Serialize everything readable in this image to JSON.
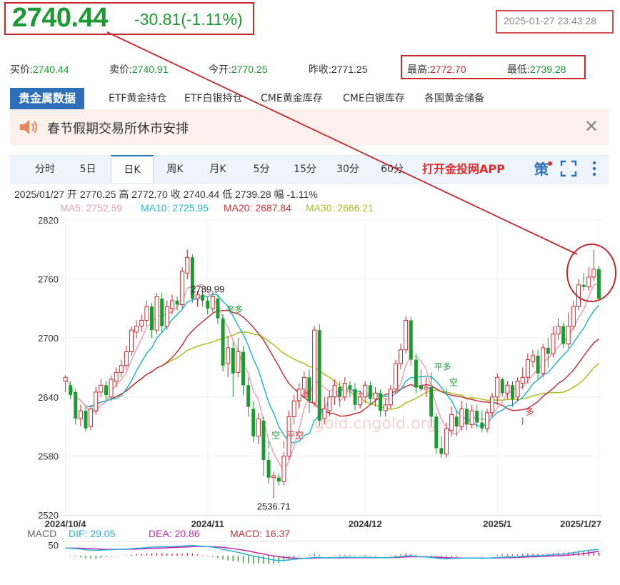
{
  "quote": {
    "price": "2740.44",
    "change": "-30.81(-1.11%)",
    "datetime": "2025-01-27 23:43:28",
    "bid_label": "买价:",
    "bid": "2740.44",
    "ask_label": "卖价:",
    "ask": "2740.91",
    "open_label": "今开:",
    "open": "2770.25",
    "prev_label": "昨收:",
    "prev": "2771.25",
    "high_label": "最高:",
    "high": "2772.70",
    "low_label": "最低:",
    "low": "2739.28"
  },
  "tabs": [
    "贵金属数据",
    "ETF黄金持仓",
    "ETF白银持仓",
    "CME黄金库存",
    "CME白银库存",
    "各国黄金储备"
  ],
  "notice": {
    "text": "春节假期交易所休市安排",
    "close": "✕"
  },
  "period_tabs": [
    "分时",
    "5日",
    "日K",
    "周K",
    "月K",
    "5分",
    "15分",
    "30分",
    "60分"
  ],
  "active_period": "日K",
  "app_link": "打开金投网APP",
  "ce_label": "策",
  "ohlc_line": "2025/01/27  开 2770.25  高 2772.70  收 2740.44  低 2739.28  幅 -1.11%",
  "ma": {
    "ma5": "MA5: 2752.59",
    "ma10": "MA10: 2725.95",
    "ma20": "MA20: 2687.84",
    "ma30": "MA30: 2666.21",
    "colors": {
      "ma5": "#f0a0b4",
      "ma10": "#27b3d8",
      "ma20": "#c8323c",
      "ma30": "#a8c020"
    }
  },
  "colors": {
    "up": "#d0272c",
    "down": "#1a9a30",
    "accent": "#2d6fb8",
    "box": "#c8262b",
    "dif": "#27b3d8",
    "dea": "#c02aa8"
  },
  "watermark": "gold.cngold.org",
  "chart_data": {
    "type": "candlestick",
    "ylim": [
      2520,
      2820
    ],
    "yticks": [
      2520,
      2580,
      2640,
      2700,
      2760,
      2820
    ],
    "x_labels": [
      {
        "i": 0,
        "label": "2024/10/4"
      },
      {
        "i": 28,
        "label": "2024/11"
      },
      {
        "i": 59,
        "label": "2024/12"
      },
      {
        "i": 85,
        "label": "2025/1"
      },
      {
        "i": 105,
        "label": "2025/1/27"
      }
    ],
    "candles": [
      [
        2656,
        2660,
        2645,
        2662
      ],
      [
        2652,
        2642,
        2638,
        2656
      ],
      [
        2645,
        2618,
        2612,
        2648
      ],
      [
        2618,
        2626,
        2610,
        2632
      ],
      [
        2626,
        2608,
        2605,
        2630
      ],
      [
        2610,
        2628,
        2606,
        2632
      ],
      [
        2626,
        2645,
        2622,
        2650
      ],
      [
        2645,
        2652,
        2640,
        2658
      ],
      [
        2652,
        2642,
        2636,
        2656
      ],
      [
        2640,
        2658,
        2636,
        2662
      ],
      [
        2656,
        2665,
        2650,
        2670
      ],
      [
        2665,
        2672,
        2660,
        2678
      ],
      [
        2672,
        2686,
        2668,
        2692
      ],
      [
        2686,
        2708,
        2682,
        2712
      ],
      [
        2706,
        2712,
        2700,
        2718
      ],
      [
        2712,
        2718,
        2706,
        2724
      ],
      [
        2718,
        2732,
        2712,
        2738
      ],
      [
        2732,
        2708,
        2700,
        2736
      ],
      [
        2708,
        2742,
        2704,
        2746
      ],
      [
        2740,
        2712,
        2706,
        2746
      ],
      [
        2712,
        2732,
        2708,
        2738
      ],
      [
        2730,
        2738,
        2724,
        2744
      ],
      [
        2738,
        2734,
        2728,
        2742
      ],
      [
        2734,
        2768,
        2730,
        2772
      ],
      [
        2766,
        2782,
        2760,
        2790
      ],
      [
        2782,
        2740,
        2736,
        2785
      ],
      [
        2740,
        2744,
        2732,
        2748
      ],
      [
        2744,
        2738,
        2732,
        2748
      ],
      [
        2738,
        2730,
        2724,
        2742
      ],
      [
        2730,
        2742,
        2726,
        2746
      ],
      [
        2740,
        2720,
        2714,
        2744
      ],
      [
        2720,
        2672,
        2666,
        2724
      ],
      [
        2674,
        2690,
        2660,
        2702
      ],
      [
        2690,
        2664,
        2640,
        2696
      ],
      [
        2665,
        2686,
        2660,
        2700
      ],
      [
        2686,
        2652,
        2642,
        2692
      ],
      [
        2652,
        2630,
        2620,
        2660
      ],
      [
        2628,
        2600,
        2594,
        2636
      ],
      [
        2600,
        2618,
        2592,
        2624
      ],
      [
        2616,
        2576,
        2560,
        2620
      ],
      [
        2576,
        2558,
        2552,
        2584
      ],
      [
        2558,
        2560,
        2537,
        2564
      ],
      [
        2558,
        2554,
        2550,
        2562
      ],
      [
        2554,
        2580,
        2550,
        2584
      ],
      [
        2580,
        2620,
        2576,
        2626
      ],
      [
        2620,
        2636,
        2612,
        2642
      ],
      [
        2636,
        2648,
        2628,
        2654
      ],
      [
        2648,
        2660,
        2640,
        2666
      ],
      [
        2660,
        2636,
        2624,
        2668
      ],
      [
        2634,
        2708,
        2630,
        2712
      ],
      [
        2708,
        2616,
        2610,
        2714
      ],
      [
        2618,
        2628,
        2612,
        2640
      ],
      [
        2626,
        2640,
        2620,
        2646
      ],
      [
        2640,
        2652,
        2632,
        2658
      ],
      [
        2650,
        2640,
        2630,
        2656
      ],
      [
        2640,
        2654,
        2636,
        2660
      ],
      [
        2652,
        2648,
        2640,
        2656
      ],
      [
        2648,
        2632,
        2626,
        2654
      ],
      [
        2632,
        2640,
        2628,
        2646
      ],
      [
        2640,
        2652,
        2634,
        2656
      ],
      [
        2652,
        2638,
        2632,
        2656
      ],
      [
        2638,
        2644,
        2630,
        2650
      ],
      [
        2644,
        2626,
        2620,
        2648
      ],
      [
        2626,
        2632,
        2620,
        2638
      ],
      [
        2632,
        2648,
        2628,
        2652
      ],
      [
        2648,
        2674,
        2644,
        2678
      ],
      [
        2674,
        2688,
        2668,
        2694
      ],
      [
        2688,
        2718,
        2684,
        2722
      ],
      [
        2718,
        2678,
        2672,
        2722
      ],
      [
        2678,
        2650,
        2644,
        2684
      ],
      [
        2652,
        2648,
        2646,
        2668
      ],
      [
        2648,
        2650,
        2640,
        2660
      ],
      [
        2650,
        2620,
        2610,
        2660
      ],
      [
        2620,
        2588,
        2582,
        2624
      ],
      [
        2588,
        2582,
        2578,
        2600
      ],
      [
        2582,
        2608,
        2578,
        2614
      ],
      [
        2606,
        2622,
        2600,
        2630
      ],
      [
        2620,
        2610,
        2600,
        2626
      ],
      [
        2610,
        2628,
        2606,
        2636
      ],
      [
        2628,
        2612,
        2606,
        2634
      ],
      [
        2612,
        2626,
        2608,
        2632
      ],
      [
        2626,
        2614,
        2608,
        2632
      ],
      [
        2614,
        2608,
        2604,
        2626
      ],
      [
        2608,
        2624,
        2604,
        2628
      ],
      [
        2624,
        2640,
        2620,
        2644
      ],
      [
        2640,
        2660,
        2632,
        2664
      ],
      [
        2658,
        2644,
        2640,
        2660
      ],
      [
        2644,
        2652,
        2638,
        2656
      ],
      [
        2652,
        2638,
        2630,
        2656
      ],
      [
        2640,
        2656,
        2636,
        2660
      ],
      [
        2654,
        2660,
        2648,
        2670
      ],
      [
        2660,
        2678,
        2654,
        2684
      ],
      [
        2676,
        2682,
        2670,
        2688
      ],
      [
        2682,
        2664,
        2658,
        2688
      ],
      [
        2664,
        2690,
        2660,
        2694
      ],
      [
        2690,
        2684,
        2670,
        2700
      ],
      [
        2684,
        2704,
        2680,
        2712
      ],
      [
        2704,
        2712,
        2698,
        2720
      ],
      [
        2712,
        2694,
        2690,
        2716
      ],
      [
        2694,
        2712,
        2690,
        2726
      ],
      [
        2712,
        2732,
        2708,
        2738
      ],
      [
        2732,
        2754,
        2728,
        2760
      ],
      [
        2754,
        2752,
        2748,
        2766
      ],
      [
        2752,
        2762,
        2748,
        2772
      ],
      [
        2762,
        2770,
        2758,
        2790
      ],
      [
        2770,
        2740,
        2739,
        2773
      ]
    ],
    "annotations": [
      {
        "i": 28,
        "label": "2789.99",
        "at": "high"
      },
      {
        "i": 41,
        "label": "2536.71",
        "at": "low"
      }
    ],
    "signals": [
      {
        "i": 31,
        "text": "平多",
        "y": 2726,
        "color": "#1a9a30"
      },
      {
        "i": 40,
        "text": "空",
        "y": 2598,
        "color": "#1a9a30"
      },
      {
        "i": 43,
        "text": "平空",
        "y": 2598,
        "color": "#d0272c"
      },
      {
        "i": 46,
        "text": "多",
        "y": 2640,
        "color": "#d0272c"
      },
      {
        "i": 72,
        "text": "平多",
        "y": 2668,
        "color": "#1a9a30"
      },
      {
        "i": 75,
        "text": "空",
        "y": 2652,
        "color": "#1a9a30"
      },
      {
        "i": 90,
        "text": "多",
        "y": 2622,
        "color": "#d0272c"
      }
    ],
    "macd": {
      "dif_label": "DIF: 29.05",
      "dea_label": "DEA: 20.86",
      "macd_label": "MACD: 16.37",
      "title": "MACD",
      "ytick": "50",
      "dif": [
        36,
        35,
        33,
        31,
        28,
        26,
        25,
        26,
        27,
        28,
        29,
        30,
        31,
        33,
        35,
        36,
        38,
        40,
        41,
        42,
        42,
        43,
        44,
        45,
        47,
        48,
        46,
        44,
        42,
        40,
        36,
        30,
        25,
        20,
        16,
        10,
        4,
        -2,
        -6,
        -11,
        -16,
        -20,
        -22,
        -22,
        -20,
        -17,
        -14,
        -12,
        -10,
        -7,
        -8,
        -10,
        -10,
        -9,
        -8,
        -7,
        -7,
        -8,
        -8,
        -7,
        -8,
        -8,
        -9,
        -9,
        -8,
        -6,
        -4,
        -1,
        -1,
        -3,
        -5,
        -6,
        -8,
        -11,
        -14,
        -15,
        -13,
        -12,
        -12,
        -11,
        -11,
        -11,
        -12,
        -11,
        -10,
        -8,
        -7,
        -6,
        -6,
        -5,
        -3,
        -1,
        0,
        0,
        1,
        3,
        5,
        7,
        8,
        11,
        14,
        18,
        22,
        25,
        28,
        29
      ],
      "dea": [
        36,
        36,
        35,
        35,
        34,
        33,
        32,
        31,
        30,
        30,
        30,
        30,
        30,
        31,
        31,
        32,
        33,
        34,
        35,
        36,
        37,
        38,
        39,
        40,
        41,
        42,
        43,
        43,
        43,
        42,
        41,
        39,
        36,
        33,
        30,
        26,
        22,
        17,
        12,
        8,
        3,
        -1,
        -5,
        -8,
        -10,
        -11,
        -12,
        -12,
        -12,
        -11,
        -10,
        -10,
        -10,
        -10,
        -10,
        -9,
        -9,
        -9,
        -9,
        -9,
        -9,
        -9,
        -9,
        -9,
        -9,
        -8,
        -7,
        -6,
        -5,
        -5,
        -5,
        -5,
        -6,
        -7,
        -8,
        -9,
        -10,
        -10,
        -11,
        -11,
        -11,
        -11,
        -11,
        -11,
        -11,
        -10,
        -10,
        -9,
        -9,
        -8,
        -7,
        -6,
        -5,
        -4,
        -3,
        -2,
        -1,
        0,
        1,
        3,
        5,
        7,
        10,
        13,
        17,
        21
      ]
    }
  }
}
